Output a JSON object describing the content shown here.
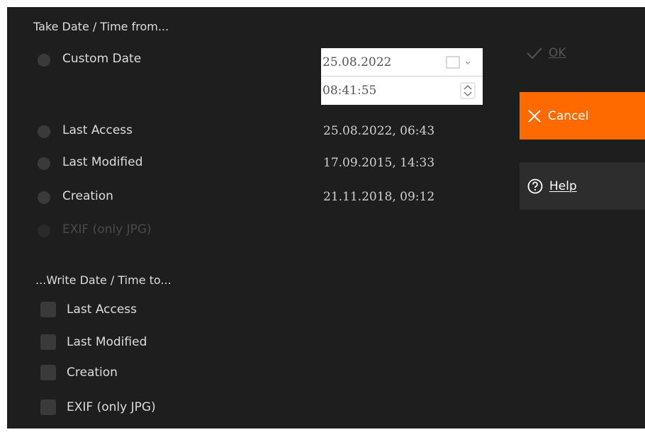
{
  "source": {
    "heading": "Take Date / Time from...",
    "custom": {
      "label": "Custom Date",
      "date": "25.08.2022",
      "time": "08:41:55"
    },
    "options": [
      {
        "label": "Last Access",
        "value": "25.08.2022, 06:43"
      },
      {
        "label": "Last Modified",
        "value": "17.09.2015, 14:33"
      },
      {
        "label": "Creation",
        "value": "21.11.2018, 09:12"
      }
    ],
    "exif_label": "EXIF (only JPG)"
  },
  "target": {
    "heading": "...Write Date / Time to...",
    "items": [
      "Last Access",
      "Last Modified",
      "Creation",
      "EXIF (only JPG)"
    ]
  },
  "buttons": {
    "ok": "OK",
    "cancel": "Cancel",
    "help": "Help"
  },
  "colors": {
    "background": "#1e1e1e",
    "accent": "#ff6a00",
    "help_bg": "#2d2d2d"
  },
  "icons": {
    "ok": "checkmark-icon",
    "cancel": "close-icon",
    "help": "help-circle-icon",
    "calendar": "calendar-dropdown-icon",
    "spin": "spinner-icon"
  }
}
